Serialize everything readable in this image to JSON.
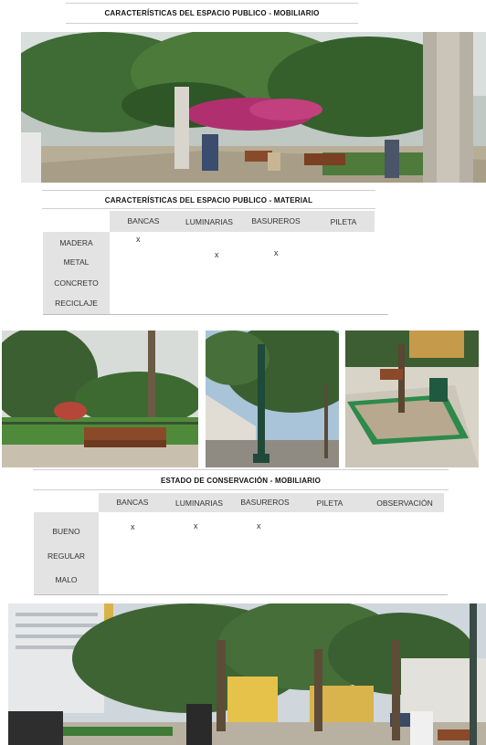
{
  "section1": {
    "title": "CARACTERÍSTICAS DEL ESPACIO PUBLICO - MOBILIARIO"
  },
  "section2": {
    "title": "CARACTERÍSTICAS DEL ESPACIO PUBLICO - MATERIAL",
    "columns": [
      "BANCAS",
      "LUMINARIAS",
      "BASUREROS",
      "PILETA"
    ],
    "rows": [
      "MADERA",
      "METAL",
      "CONCRETO",
      "RECICLAJE"
    ],
    "marks": [
      {
        "row": "MADERA",
        "col": "BANCAS",
        "text": "x"
      },
      {
        "row": "METAL",
        "col": "LUMINARIAS",
        "text": "x"
      },
      {
        "row": "METAL",
        "col": "BASUREROS",
        "text": "x"
      }
    ]
  },
  "section3": {
    "title": "ESTADO DE CONSERVACIÓN - MOBILIARIO",
    "columns": [
      "BANCAS",
      "LUMINARIAS",
      "BASUREROS",
      "PILETA",
      "OBSERVACIÓN"
    ],
    "rows": [
      "BUENO",
      "REGULAR",
      "MALO"
    ],
    "marks": [
      {
        "row": "BUENO",
        "col": "BANCAS",
        "text": "x"
      },
      {
        "row": "BUENO",
        "col": "LUMINARIAS",
        "text": "x"
      },
      {
        "row": "BUENO",
        "col": "BASUREROS",
        "text": "x"
      }
    ]
  }
}
